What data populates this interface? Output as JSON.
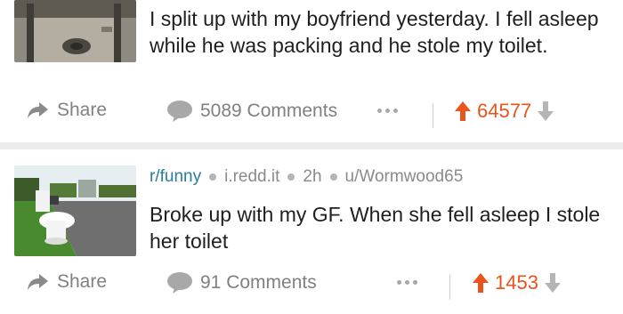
{
  "posts": [
    {
      "title": "I split up with my boyfriend yesterday. I fell asleep while he was packing and he stole my toilet.",
      "share_label": "Share",
      "comments_label": "5089 Comments",
      "score": "64577"
    },
    {
      "subreddit": "r/funny",
      "domain": "i.redd.it",
      "age": "2h",
      "author": "u/Wormwood65",
      "title": "Broke up with my GF. When she fell asleep I stole her toilet",
      "share_label": "Share",
      "comments_label": "91 Comments",
      "score": "1453"
    }
  ],
  "colors": {
    "upvote": "#e8541b",
    "subreddit": "#2a7d9e",
    "muted": "#808080"
  },
  "icons": [
    "share-arrow-icon",
    "comment-bubble-icon",
    "more-dots-icon",
    "upvote-arrow-icon",
    "downvote-arrow-icon"
  ]
}
